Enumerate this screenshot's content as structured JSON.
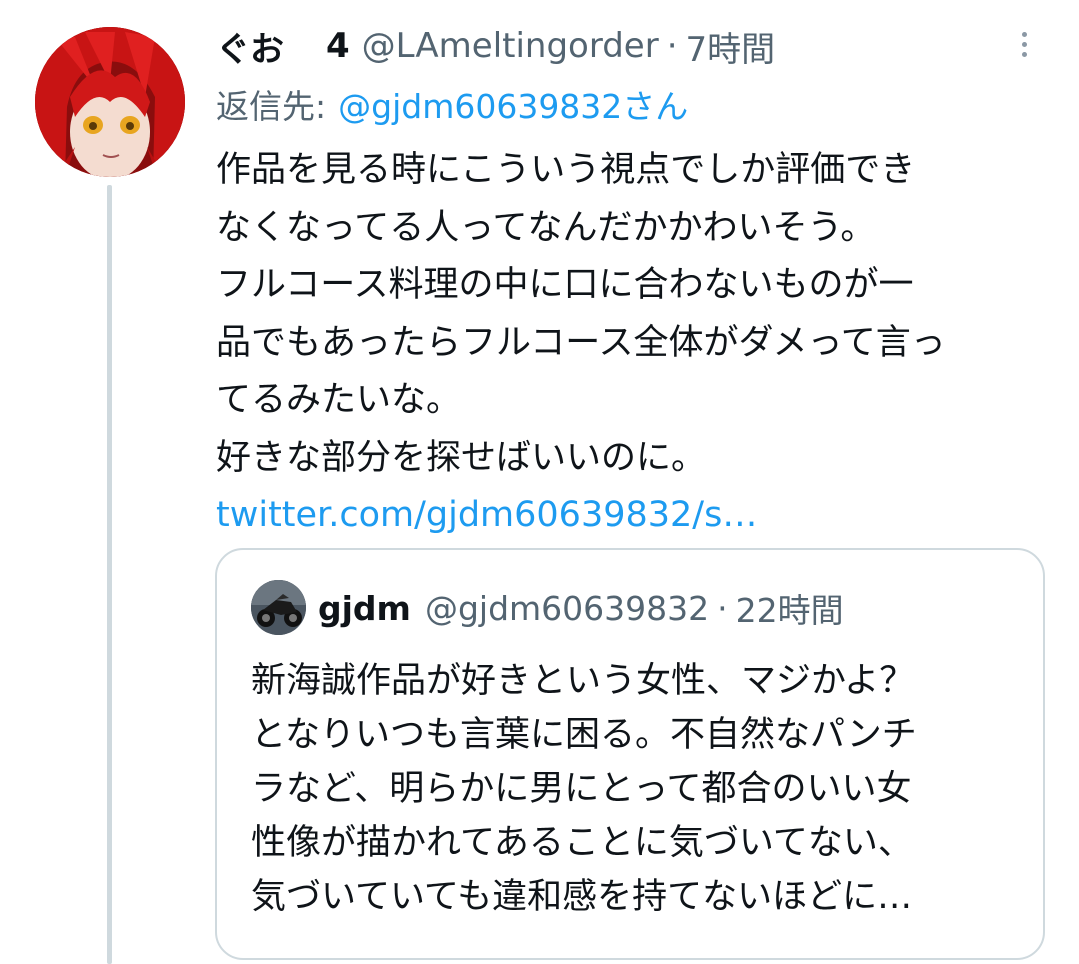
{
  "tweet": {
    "author": {
      "display_name": "ぐお",
      "display_suffix": "4",
      "handle": "@LAmeltingorder",
      "time": "7時間"
    },
    "separator": "·",
    "reply_prefix": "返信先:",
    "reply_to": "@gjdm60639832さん",
    "lines": [
      "作品を見る時にこういう視点でしか評価でき",
      "なくなってる人ってなんだかかわいそう。",
      "フルコース料理の中に口に合わないものが一",
      "品でもあったらフルコース全体がダメって言っ",
      "てるみたいな。",
      "好きな部分を探せばいいのに。"
    ],
    "link": "twitter.com/gjdm60639832/s…"
  },
  "quoted": {
    "display_name": "gjdm",
    "handle": "@gjdm60639832",
    "separator": "·",
    "time": "22時間",
    "lines": [
      "新海誠作品が好きという女性、マジかよ？",
      "となりいつも言葉に困る。不自然なパンチ",
      "ラなど、明らかに男にとって都合のいい女",
      "性像が描かれてあることに気づいてない、",
      "気づいていても違和感を持てないほどに…"
    ]
  },
  "icons": {
    "more": "more-vertical-icon",
    "avatar": "anime-avatar",
    "quoted_avatar": "motorcycle-avatar"
  },
  "colors": {
    "text": "#0f1419",
    "secondary": "#536471",
    "link": "#1d9bf0",
    "border": "#cfd9de"
  }
}
